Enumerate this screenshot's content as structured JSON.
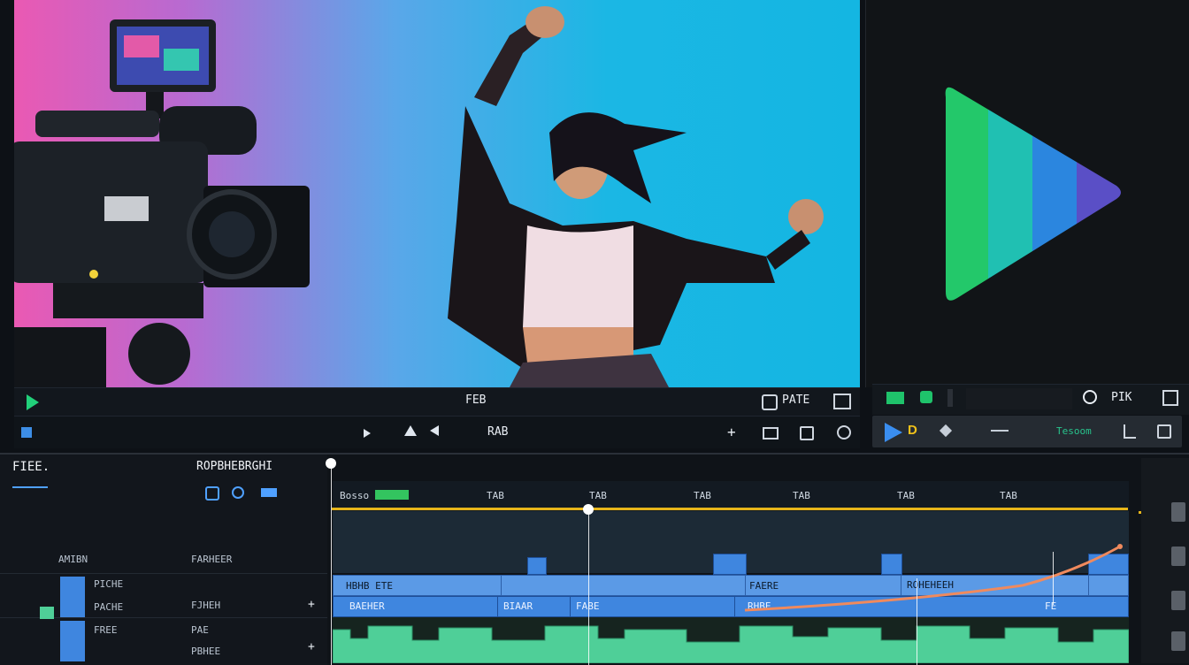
{
  "preview": {
    "toolbar_center": "FEB",
    "toolbar_right": "PATE",
    "toolbar2_text": "RAB"
  },
  "rightpanel": {
    "toolbar_right": "PIK",
    "toolbar2_label": "Tesoom",
    "toolbar2_d": "D"
  },
  "timeline": {
    "header_left": "FIEE.",
    "header_right": "ROPBHEBRGHI",
    "layer1": "AMIBN",
    "layer1_sub": "FARHEER",
    "track_left1": "PICHE",
    "track_left2": "PACHE",
    "track_left3": "FREE",
    "track_mid1": "FJHEH",
    "track_mid2": "PAE",
    "track_mid3": "PBHEE",
    "ruler_first": "Bosso",
    "ruler_labels": [
      "TAB",
      "TAB",
      "TAB",
      "TAB",
      "TAB",
      "TAB"
    ],
    "clip1": "HBHB ETE",
    "clip2": "FAERE",
    "clip3": "ROHEHEEH",
    "clip_b1": "BAEHER",
    "clip_b2": "BIAAR",
    "clip_b3": "FABE",
    "clip_b4": "RHBE",
    "clip_b5": "FE"
  },
  "colors": {
    "accent_yellow": "#e6b51a",
    "clip_blue": "#5b9ae6",
    "clip_green": "#4fcf98",
    "curve": "#f08a5d"
  },
  "icons": [
    "camera-illustration",
    "play-triangle-logo",
    "dancer-figure",
    "search-icon",
    "expand-icon",
    "play-icon",
    "add-icon"
  ]
}
